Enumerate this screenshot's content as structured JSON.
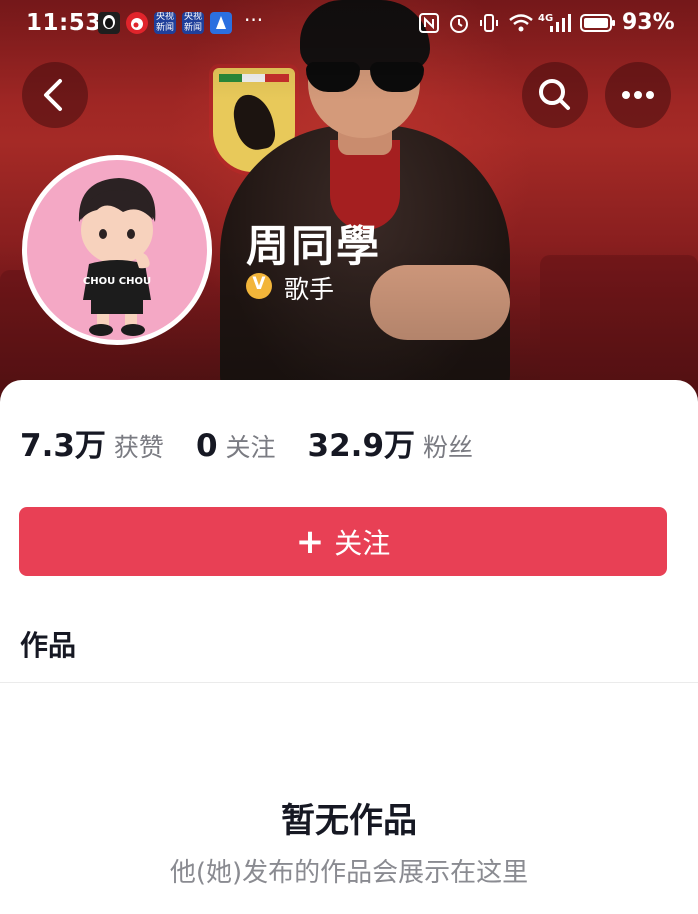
{
  "status_bar": {
    "time": "11:53",
    "apps": [
      {
        "icon": "qq-icon",
        "text": ""
      },
      {
        "icon": "weibo-icon",
        "text": ""
      },
      {
        "icon": "cctv-news-icon",
        "text": "央视新闻"
      },
      {
        "icon": "cctv-news-icon",
        "text": "央视新闻"
      },
      {
        "icon": "app-icon",
        "text": ""
      }
    ],
    "more": "···",
    "network": "4G",
    "battery": "93%"
  },
  "profile": {
    "name": "周同學",
    "verified_badge": "V",
    "role": "歌手",
    "avatar_shirt_text": "CHOU CHOU"
  },
  "stats": [
    {
      "value": "7.3万",
      "label": "获赞"
    },
    {
      "value": "0",
      "label": "关注"
    },
    {
      "value": "32.9万",
      "label": "粉丝"
    }
  ],
  "follow_button": {
    "plus": "+",
    "label": "关注"
  },
  "tabs": {
    "works": "作品"
  },
  "empty_state": {
    "title": "暂无作品",
    "subtitle": "他(她)发布的作品会展示在这里"
  },
  "colors": {
    "accent": "#e84055",
    "banner": "#9e2624",
    "badge": "#f2b53a",
    "avatar_bg": "#f4a8c5"
  }
}
